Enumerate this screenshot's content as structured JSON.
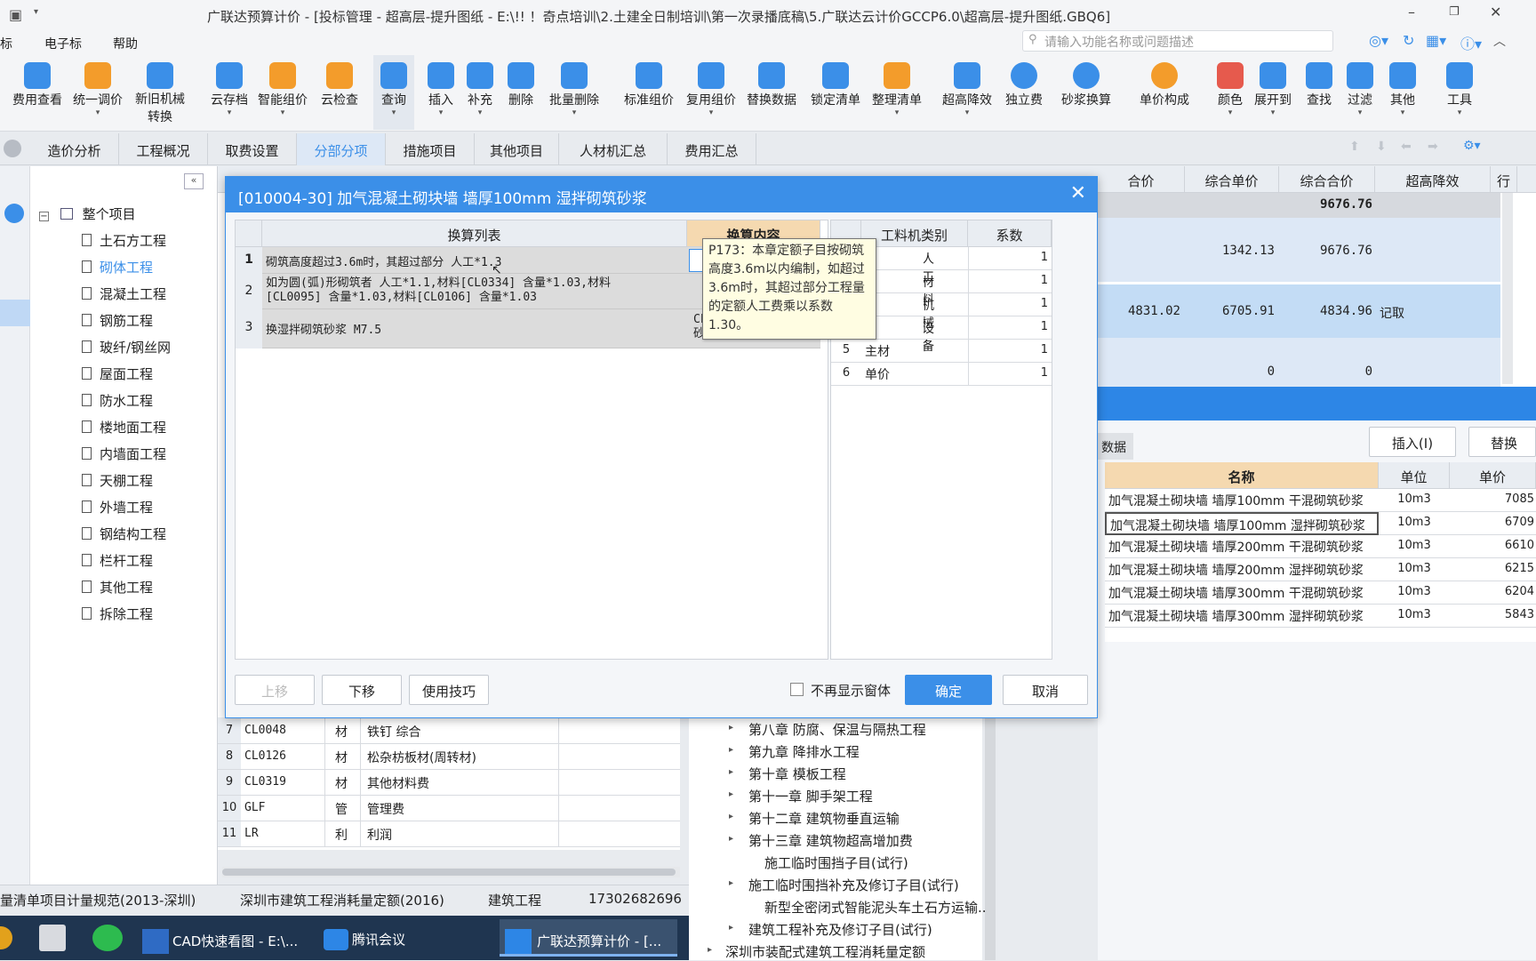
{
  "title": "广联达预算计价 - [投标管理 - 超高层-提升图纸 - E:\\!! ！奇点培训\\2.土建全日制培训\\第一次录播底稿\\5.广联达云计价GCCP6.0\\超高层-提升图纸.GBQ6]",
  "menu": {
    "m1": "标",
    "m2": "电子标",
    "m3": "帮助"
  },
  "search_placeholder": "请输入功能名称或问题描述",
  "toolbar": [
    "费用查看",
    "统一调价",
    "新旧机械转换",
    "云存档",
    "智能组价",
    "云检查",
    "查询",
    "插入",
    "补充",
    "删除",
    "批量删除",
    "标准组价",
    "复用组价",
    "替换数据",
    "锁定清单",
    "整理清单",
    "超高降效",
    "独立费",
    "砂浆换算",
    "单价构成",
    "颜色",
    "展开到",
    "查找",
    "过滤",
    "其他",
    "工具"
  ],
  "tabs": [
    "造价分析",
    "工程概况",
    "取费设置",
    "分部分项",
    "措施项目",
    "其他项目",
    "人材机汇总",
    "费用汇总"
  ],
  "tree": {
    "root": "整个项目",
    "items": [
      "土石方工程",
      "砌体工程",
      "混凝土工程",
      "钢筋工程",
      "玻纤/钢丝网",
      "屋面工程",
      "防水工程",
      "楼地面工程",
      "内墙面工程",
      "天棚工程",
      "外墙工程",
      "钢结构工程",
      "栏杆工程",
      "其他工程",
      "拆除工程"
    ]
  },
  "grid_headers": [
    "合价",
    "综合单价",
    "综合合价",
    "超高降效",
    "行"
  ],
  "grid": {
    "total": "9676.76",
    "r1": {
      "unit": "1342.13",
      "total": "9676.76"
    },
    "r2": {
      "price": "4831.02",
      "unit": "6705.91",
      "total": "4834.96",
      "drop": "记取"
    },
    "r3": {
      "unit": "0",
      "total": "0"
    }
  },
  "dialog": {
    "title": "[010004-30] 加气混凝土砌块墙 墙厚100mm 湿拌砌筑砂浆",
    "col_list": "换算列表",
    "col_content": "换算内容",
    "rows": [
      {
        "n": "1",
        "text": "砌筑高度超过3.6m时，其超过部分 人工*1.3"
      },
      {
        "n": "2",
        "text": "如为圆(弧)形砌筑者 人工*1.1,材料[CL0334] 含量*1.03,材料[CL0095] 含量*1.03,材料[CL0106] 含量*1.03"
      },
      {
        "n": "3",
        "text": "换湿拌砌筑砂浆 M7.5",
        "content": "CL 砂"
      }
    ],
    "col_type": "工料机类别",
    "col_coef": "系数",
    "types": [
      {
        "n": "1",
        "name": "人工",
        "coef": "1"
      },
      {
        "n": "2",
        "name": "材料",
        "coef": "1"
      },
      {
        "n": "3",
        "name": "机械",
        "coef": "1"
      },
      {
        "n": "4",
        "name": "设备",
        "coef": "1"
      },
      {
        "n": "5",
        "name": "主材",
        "coef": "1"
      },
      {
        "n": "6",
        "name": "单价",
        "coef": "1"
      }
    ],
    "tooltip": "P173：本章定额子目按砌筑高度3.6m以内编制，如超过3.6m时，其超过部分工程量的定额人工费乘以系数1.30。",
    "btn_up": "上移",
    "btn_down": "下移",
    "btn_tips": "使用技巧",
    "no_show": "不再显示窗体",
    "ok": "确定",
    "cancel": "取消"
  },
  "right_panel": {
    "tab_data": "数据",
    "insert": "插入(I)",
    "replace": "替换",
    "headers": [
      "名称",
      "单位",
      "单价"
    ],
    "rows": [
      {
        "name": "加气混凝土砌块墙 墙厚100mm 干混砌筑砂浆",
        "unit": "10m3",
        "price": "7085"
      },
      {
        "name": "加气混凝土砌块墙 墙厚100mm 湿拌砌筑砂浆",
        "unit": "10m3",
        "price": "6709"
      },
      {
        "name": "加气混凝土砌块墙 墙厚200mm 干混砌筑砂浆",
        "unit": "10m3",
        "price": "6610"
      },
      {
        "name": "加气混凝土砌块墙 墙厚200mm 湿拌砌筑砂浆",
        "unit": "10m3",
        "price": "6215"
      },
      {
        "name": "加气混凝土砌块墙 墙厚300mm 干混砌筑砂浆",
        "unit": "10m3",
        "price": "6204"
      },
      {
        "name": "加气混凝土砌块墙 墙厚300mm 湿拌砌筑砂浆",
        "unit": "10m3",
        "price": "5843"
      }
    ]
  },
  "materials": [
    {
      "n": "7",
      "code": "CL0048",
      "type": "材",
      "name": "铁钉 综合"
    },
    {
      "n": "8",
      "code": "CL0126",
      "type": "材",
      "name": "松杂枋板材(周转材)"
    },
    {
      "n": "9",
      "code": "CL0319",
      "type": "材",
      "name": "其他材料费"
    },
    {
      "n": "10",
      "code": "GLF",
      "type": "管",
      "name": "管理费"
    },
    {
      "n": "11",
      "code": "LR",
      "type": "利",
      "name": "利润"
    }
  ],
  "library": [
    "第八章 防腐、保温与隔热工程",
    "第九章 降排水工程",
    "第十章 模板工程",
    "第十一章 脚手架工程",
    "第十二章 建筑物垂直运输",
    "第十三章 建筑物超高增加费",
    "施工临时围挡子目(试行)",
    "施工临时围挡补充及修订子目(试行)",
    "新型全密闭式智能泥头车土石方运输...",
    "建筑工程补充及修订子目(试行)",
    "深圳市装配式建筑工程消耗量定额"
  ],
  "status": {
    "s1": "量清单项目计量规范(2013-深圳)",
    "s2": "深圳市建筑工程消耗量定额(2016)",
    "s3": "建筑工程",
    "s4": "17302682696"
  },
  "taskbar": {
    "t1": "CAD快速看图 - E:\\...",
    "t2": "腾讯会议",
    "t3": "广联达预算计价 - [..."
  }
}
